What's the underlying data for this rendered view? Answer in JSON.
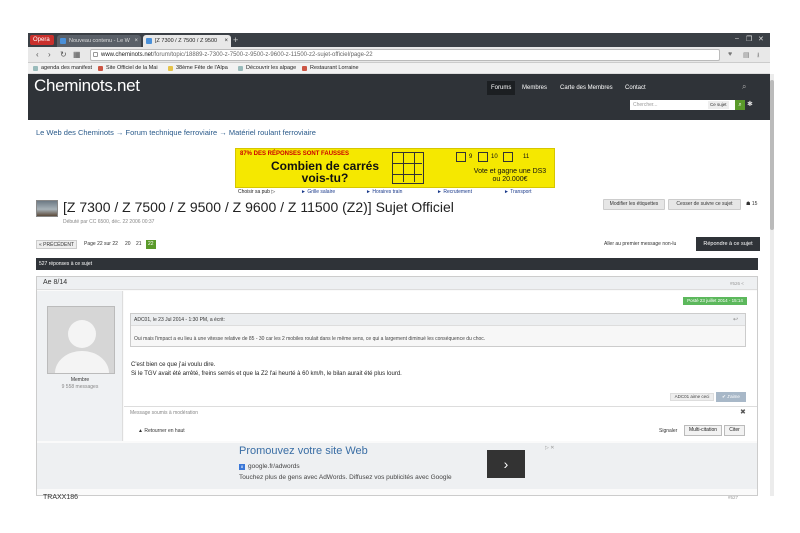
{
  "browser": {
    "opera": "Opera",
    "tabs": [
      "Nouveau contenu - Le W",
      "[Z 7300 / Z 7500 / Z 9500"
    ],
    "new_tab": "+",
    "controls": [
      "–",
      "❐",
      "✕"
    ],
    "url_host": "www.cheminots.net",
    "url_path": "/forum/topic/18889-z-7300-z-7500-z-9500-z-9600-z-11500-z2-sujet-officiel/page-22",
    "bookmarks": [
      "agenda des manifest",
      "Site Officiel de la Mai",
      "38ème Fête de l'Alpa",
      "Découvrir les alpage",
      "Restaurant Lorraine"
    ]
  },
  "header": {
    "logo": "Cheminots.net",
    "nav": [
      "Forums",
      "Membres",
      "Carte des Membres",
      "Contact"
    ],
    "search_placeholder": "Chercher...",
    "search_scope": "Ce sujet"
  },
  "breadcrumb": "Le Web des Cheminots  →  Forum technique ferroviaire  →  Matériel roulant ferroviaire",
  "ad": {
    "top": "87% DES RÉPONSES SONT FAUSSES",
    "main": "Combien de carrés vois-tu?",
    "nums": [
      "9",
      "10",
      "11"
    ],
    "sub": "Vote et gagne une DS3 ou 20.000€",
    "label": "Choisir sa pub ▷",
    "links": [
      "► Grille salaire",
      "► Horaires train",
      "► Recrutement",
      "► Transport"
    ]
  },
  "thread": {
    "title": "[Z 7300 / Z 7500 / Z 9500 / Z 9600 / Z 11500 (Z2)] Sujet Officiel",
    "started": "Débuté par CC 6500, déc. 22 2006 00:37",
    "btn_tags": "Modifier les étiquettes",
    "btn_unfollow": "Cesser de suivre ce sujet",
    "watchers": "15"
  },
  "pagination": {
    "prev": "PRÉCÉDENT",
    "info": "Page 22 sur 22",
    "pages": [
      "20",
      "21"
    ],
    "current": "22",
    "next_unread": "Aller au premier message non-lu",
    "reply": "Répondre à ce sujet"
  },
  "post": {
    "replies": "527 réponses à ce sujet",
    "author": "Ae 8/14",
    "num": "#526",
    "role": "Membre",
    "messages": "9 558 messages",
    "date": "Posté 23 juillet 2014 - 15:14",
    "quote_head": "ADC01, le 23 Jul 2014 - 1:30 PM, a écrit:",
    "quote_text": "Oui mais l'impact a eu lieu à une vitesse relative de 85 - 30 car les 2 mobiles roulait dans le même sens, ce qui a largement diminué les conséquence du choc.",
    "text1": "C'est bien ce que j'ai voulu dire.",
    "text2": "Si le TGV avait été arrêté, freins serrés et que la Z2 l'ai heurté à 60 km/h, le bilan aurait été plus lourd.",
    "likes": "ADC01 aime ceci",
    "like_btn": "✔ J'aime",
    "mod_note": "Message soumis à modération",
    "back_top": "Retourner en haut",
    "signal": "Signaler",
    "multi": "Multi-citation",
    "cite": "Citer"
  },
  "adword": {
    "title": "Promouvez votre site Web",
    "url": "google.fr/adwords",
    "desc": "Touchez plus de gens avec AdWords. Diffusez vos publicités avec Google",
    "go": "›",
    "choices": "▷ ✕"
  },
  "next_post": {
    "author": "TRAXX186",
    "num": "#527"
  }
}
